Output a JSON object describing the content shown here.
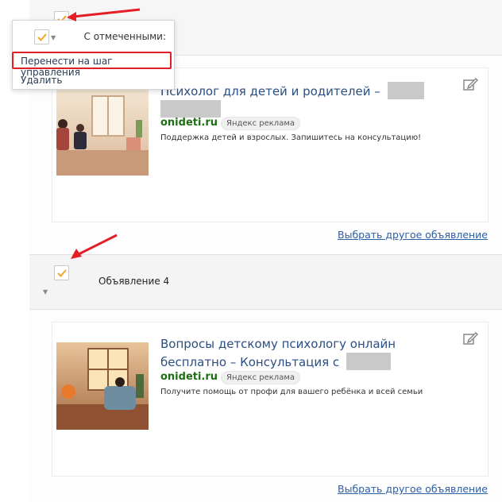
{
  "bulk_menu": {
    "header": "С отмеченными:",
    "move_item": "Перенести на шаг управления",
    "delete_item": "Удалить"
  },
  "ads": [
    {
      "title_prefix": "Психолог для детей и родителей –",
      "domain": "onideti.ru",
      "badge": "Яндекс реклама",
      "description": "Поддержка детей и взрослых. Запишитесь на консультацию!",
      "change_link": "Выбрать другое объявление"
    },
    {
      "title_prefix": "Вопросы детскому психологу онлайн бесплатно – Консультация с",
      "domain": "onideti.ru",
      "badge": "Яндекс реклама",
      "description": "Получите помощь от профи для вашего ребёнка и всей семьи",
      "change_link": "Выбрать другое объявление"
    }
  ],
  "row_label": "Объявление 4",
  "colors": {
    "accent": "#f5a623",
    "annotation_red": "#e51e25",
    "link": "#2b5ea8",
    "domain_green": "#1e6f14"
  }
}
